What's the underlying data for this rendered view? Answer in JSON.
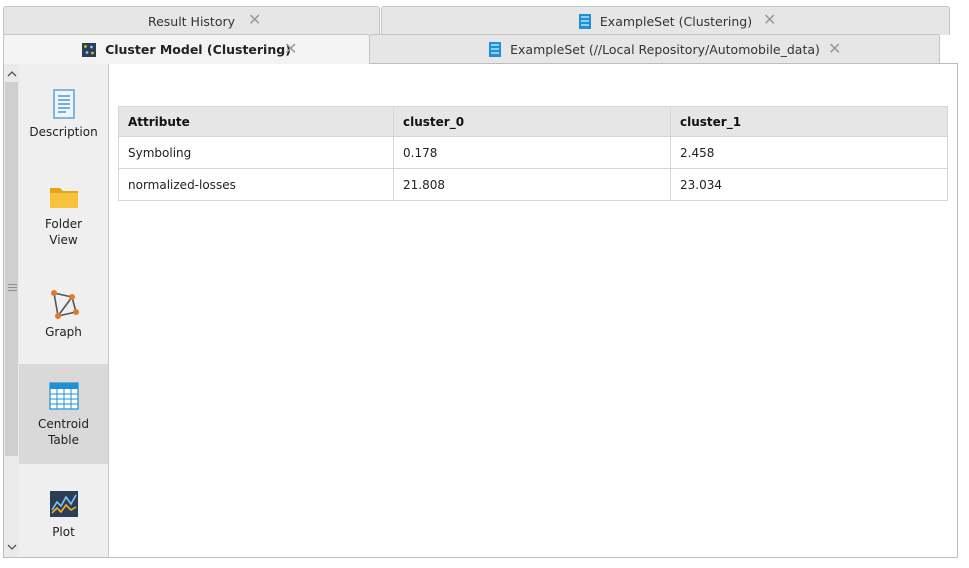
{
  "tabs_row1": [
    {
      "label": "Result History",
      "icon": "history-icon"
    },
    {
      "label": "ExampleSet (Clustering)",
      "icon": "exampleset-icon"
    }
  ],
  "tabs_row2": [
    {
      "label": "Cluster Model (Clustering)",
      "icon": "cluster-model-icon",
      "active": true
    },
    {
      "label": "ExampleSet (//Local Repository/Automobile_data)",
      "icon": "exampleset-icon"
    }
  ],
  "sidebar": {
    "items": [
      {
        "label": "Description",
        "icon": "document-icon"
      },
      {
        "label": "Folder\nView",
        "icon": "folder-icon"
      },
      {
        "label": "Graph",
        "icon": "graph-icon"
      },
      {
        "label": "Centroid\nTable",
        "icon": "table-icon",
        "selected": true
      },
      {
        "label": "Plot",
        "icon": "plot-icon"
      }
    ]
  },
  "centroid_table": {
    "columns": [
      "Attribute",
      "cluster_0",
      "cluster_1"
    ],
    "rows": [
      [
        "Symboling",
        "0.178",
        "2.458"
      ],
      [
        "normalized-losses",
        "21.808",
        "23.034"
      ]
    ]
  },
  "colors": {
    "tab_bg": "#e6e6e6",
    "active_tab_bg": "#f3f3f3",
    "sidebar_bg": "#efefef",
    "selected_item_bg": "#d9d9d9",
    "table_header_bg": "#e6e6e6",
    "accent_blue": "#1f8fd6",
    "folder_orange": "#f6b01e"
  }
}
